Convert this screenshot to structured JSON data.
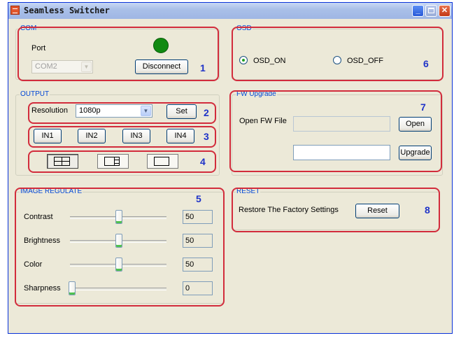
{
  "window": {
    "title": "Seamless Switcher"
  },
  "com": {
    "group_title": "COM",
    "port_label": "Port",
    "port_value": "COM2",
    "disconnect_label": "Disconnect",
    "callout": "1",
    "status_color": "#118a11"
  },
  "output": {
    "group_title": "OUTPUT",
    "resolution_label": "Resolution",
    "resolution_value": "1080p",
    "set_label": "Set",
    "callout_resolution": "2",
    "inputs": [
      "IN1",
      "IN2",
      "IN3",
      "IN4"
    ],
    "callout_inputs": "3",
    "layouts": [
      "quad-split",
      "picture-in-picture",
      "full-screen"
    ],
    "selected_layout": "quad-split",
    "callout_layouts": "4"
  },
  "image_regulate": {
    "group_title": "IMAGE REGULATE",
    "callout": "5",
    "sliders": [
      {
        "label": "Contrast",
        "value": "50"
      },
      {
        "label": "Brightness",
        "value": "50"
      },
      {
        "label": "Color",
        "value": "50"
      },
      {
        "label": "Sharpness",
        "value": "0"
      }
    ]
  },
  "osd": {
    "group_title": "OSD",
    "on_label": "OSD_ON",
    "off_label": "OSD_OFF",
    "selected": "OSD_ON",
    "callout": "6"
  },
  "fw_upgrade": {
    "group_title": "FW Upgrade",
    "open_fw_label": "Open FW File",
    "open_label": "Open",
    "upgrade_label": "Upgrade",
    "callout": "7"
  },
  "reset": {
    "group_title": "RESET",
    "restore_label": "Restore The Factory Settings",
    "reset_label": "Reset",
    "callout": "8"
  },
  "colors": {
    "callout_border": "#d22c3c",
    "callout_number": "#1f33c8",
    "group_title": "#0046d5"
  }
}
